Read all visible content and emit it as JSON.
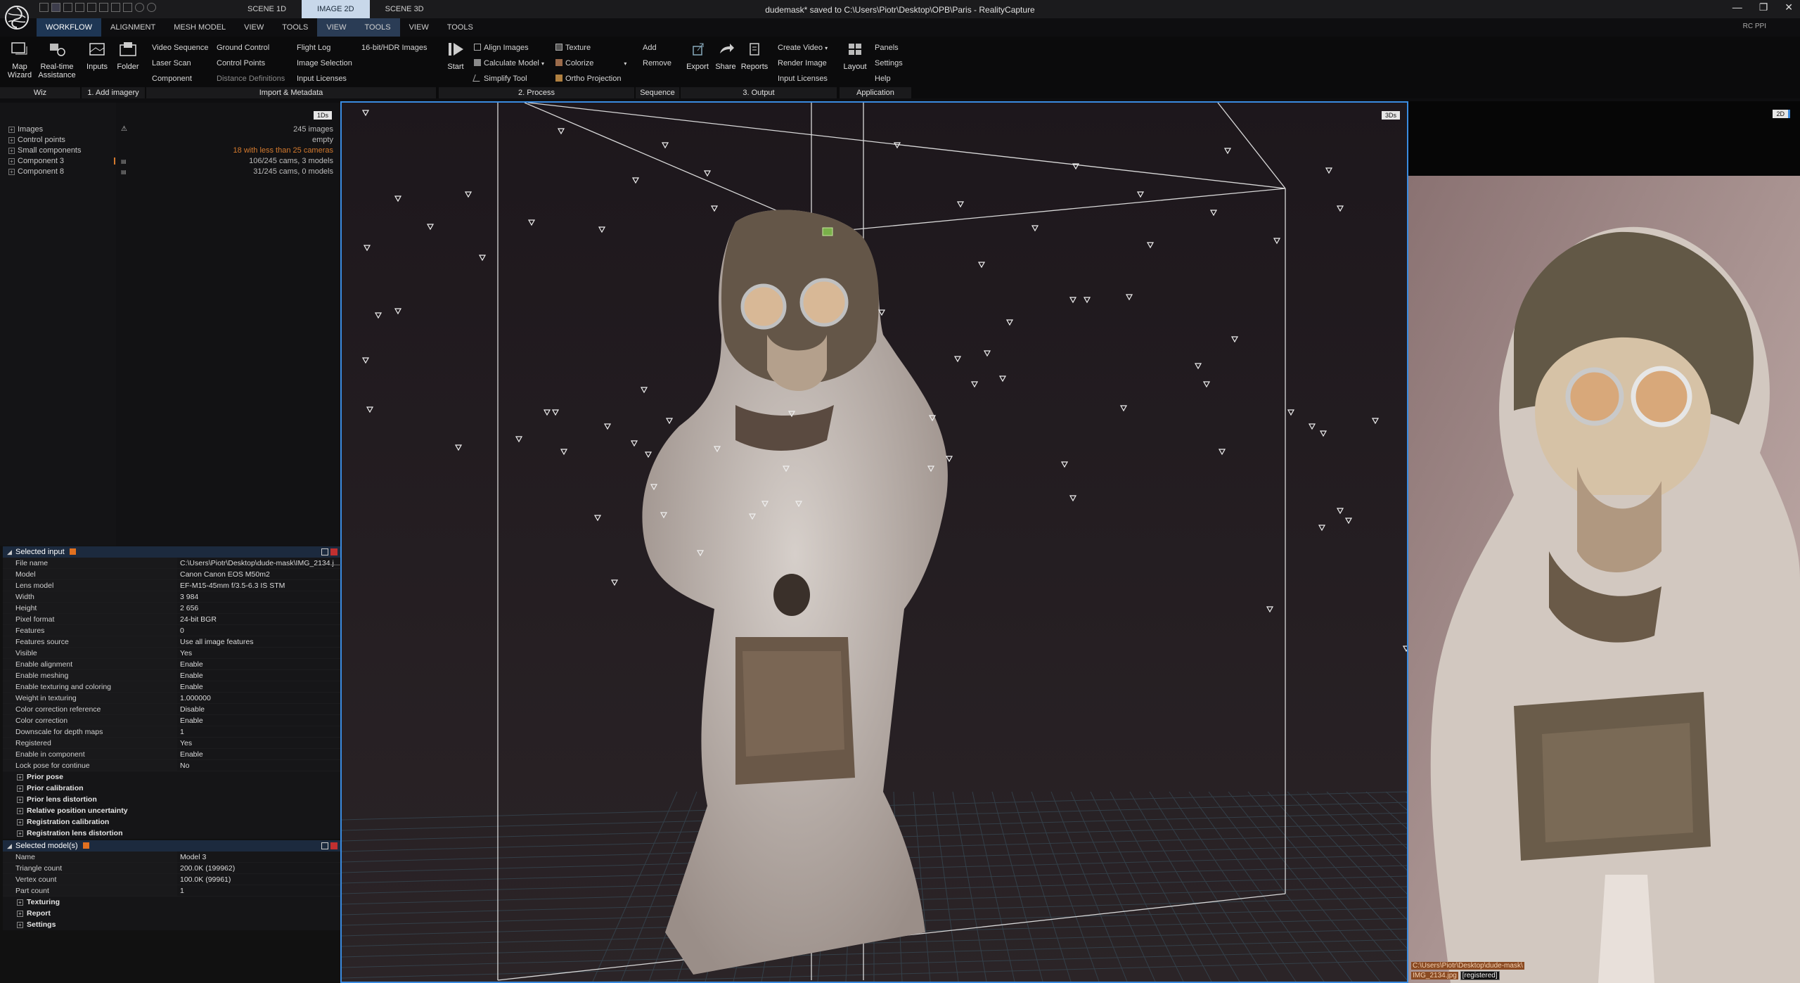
{
  "window": {
    "title": "dudemask* saved to C:\\Users\\Piotr\\Desktop\\OPB\\Paris - RealityCapture",
    "tabs": [
      {
        "label": "SCENE 1D",
        "active": false
      },
      {
        "label": "IMAGE 2D",
        "active": true
      },
      {
        "label": "SCENE 3D",
        "active": false
      }
    ],
    "controls": [
      "—",
      "❐",
      "✕"
    ],
    "rc_ppi": "RC PPI"
  },
  "ribbon_tabs": [
    {
      "label": "WORKFLOW",
      "active": true
    },
    {
      "label": "ALIGNMENT"
    },
    {
      "label": "MESH MODEL"
    },
    {
      "label": "VIEW"
    },
    {
      "label": "TOOLS"
    },
    {
      "label": "VIEW",
      "hl": true
    },
    {
      "label": "TOOLS",
      "hl": true
    },
    {
      "label": "VIEW"
    },
    {
      "label": "TOOLS"
    }
  ],
  "ribbon": {
    "groups": {
      "wiz": "Wiz",
      "add_imagery": "1. Add imagery",
      "import_metadata": "Import & Metadata",
      "process": "2. Process",
      "sequence": "Sequence",
      "output": "3. Output",
      "application": "Application"
    },
    "map_wizard": "Map Wizard",
    "realtime": "Real-time Assistance",
    "inputs": "Inputs",
    "folder": "Folder",
    "video_sequence": "Video Sequence",
    "laser_scan": "Laser Scan",
    "component": "Component",
    "ground_control": "Ground Control",
    "control_points": "Control Points",
    "distance_definitions": "Distance Definitions",
    "flight_log": "Flight Log",
    "image_selection": "Image Selection",
    "input_licenses": "Input Licenses",
    "hdr_images": "16-bit/HDR Images",
    "start": "Start",
    "align_images": "Align Images",
    "calculate_model": "Calculate Model",
    "simplify_tool": "Simplify Tool",
    "texture": "Texture",
    "colorize": "Colorize",
    "ortho_projection": "Ortho Projection",
    "add": "Add",
    "remove": "Remove",
    "export": "Export",
    "share": "Share",
    "reports": "Reports",
    "create_video": "Create Video",
    "render_image": "Render Image",
    "input_licenses_out": "Input Licenses",
    "layout": "Layout",
    "panels": "Panels",
    "settings": "Settings",
    "help": "Help"
  },
  "tree": {
    "badge": "1Ds",
    "rows": [
      {
        "label": "Images",
        "value": "245 images",
        "orange": false
      },
      {
        "label": "Control points",
        "value": "empty",
        "orange": false
      },
      {
        "label": "Small components",
        "value": "18 with less than 25 cameras",
        "orange": true
      },
      {
        "label": "Component 3",
        "value": "106/245 cams, 3 models",
        "orange": false
      },
      {
        "label": "Component 8",
        "value": "31/245 cams, 0 models",
        "orange": false
      }
    ]
  },
  "selected_input": {
    "title": "Selected input",
    "rows": [
      {
        "k": "File name",
        "v": "C:\\Users\\Piotr\\Desktop\\dude-mask\\IMG_2134.j..."
      },
      {
        "k": "Model",
        "v": "Canon Canon EOS M50m2"
      },
      {
        "k": "Lens model",
        "v": "EF-M15-45mm f/3.5-6.3 IS STM"
      },
      {
        "k": "Width",
        "v": "3 984"
      },
      {
        "k": "Height",
        "v": "2 656"
      },
      {
        "k": "Pixel format",
        "v": "24-bit BGR"
      },
      {
        "k": "Features",
        "v": "0"
      },
      {
        "k": "Features source",
        "v": "Use all image features"
      },
      {
        "k": "Visible",
        "v": "Yes"
      },
      {
        "k": "Enable alignment",
        "v": "Enable"
      },
      {
        "k": "Enable meshing",
        "v": "Enable"
      },
      {
        "k": "Enable texturing and coloring",
        "v": "Enable"
      },
      {
        "k": "Weight in texturing",
        "v": "1.000000"
      },
      {
        "k": "Color correction reference",
        "v": "Disable"
      },
      {
        "k": "Color correction",
        "v": "Enable"
      },
      {
        "k": "Downscale for depth maps",
        "v": "1"
      },
      {
        "k": "Registered",
        "v": "Yes"
      },
      {
        "k": "Enable in component",
        "v": "Enable"
      },
      {
        "k": "Lock pose for continue",
        "v": "No"
      }
    ],
    "groups": [
      "Prior pose",
      "Prior calibration",
      "Prior lens distortion",
      "Relative position uncertainty",
      "Registration calibration",
      "Registration lens distortion"
    ]
  },
  "selected_models": {
    "title": "Selected model(s)",
    "rows": [
      {
        "k": "Name",
        "v": "Model 3"
      },
      {
        "k": "Triangle count",
        "v": "200.0K (199962)"
      },
      {
        "k": "Vertex count",
        "v": "100.0K (99961)"
      },
      {
        "k": "Part count",
        "v": "1"
      }
    ],
    "groups": [
      "Texturing",
      "Report",
      "Settings"
    ]
  },
  "view3d": {
    "badge": "3Ds"
  },
  "view2d": {
    "badge": "2D",
    "path": "C:\\Users\\Piotr\\Desktop\\dude-mask\\",
    "file": "IMG_2134.jpg",
    "status": "[registered]"
  },
  "colors": {
    "accent": "#3a8be0",
    "warning": "#d47a2e",
    "active_tab": "#1e3654"
  }
}
